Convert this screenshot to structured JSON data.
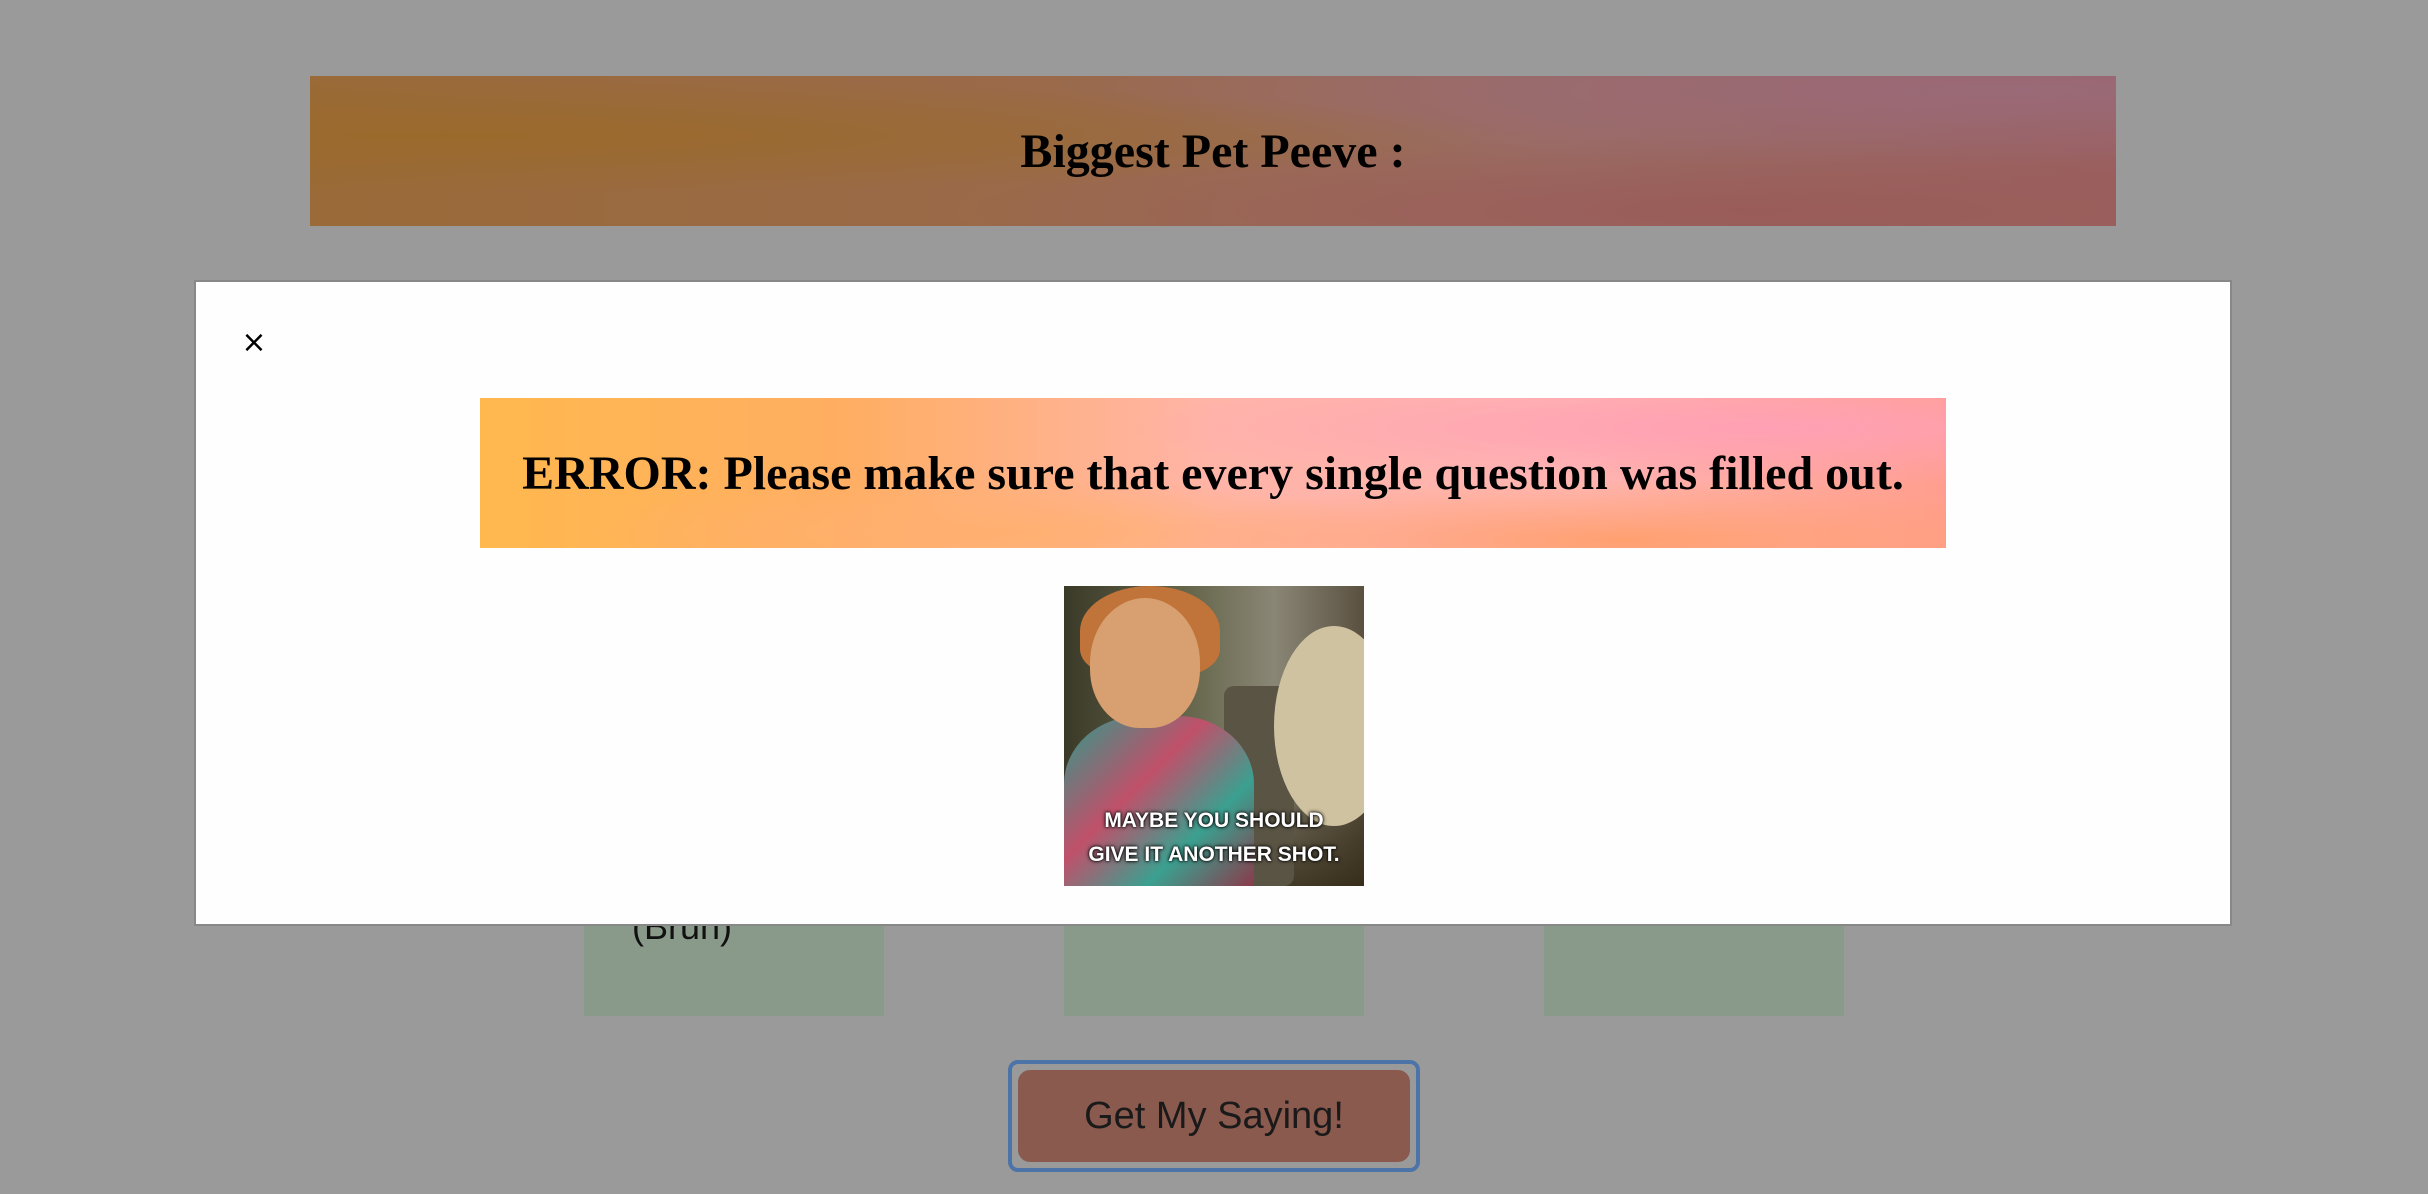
{
  "question": {
    "title": "Biggest Pet Peeve :"
  },
  "choices": [
    {
      "label": "(Bruh)"
    },
    {
      "label": ""
    },
    {
      "label": ""
    }
  ],
  "submit": {
    "label": "Get My Saying!"
  },
  "modal": {
    "close_symbol": "×",
    "error_message": "ERROR: Please make sure that every single question was filled out.",
    "gif_caption": "MAYBE YOU SHOULD\nGIVE IT ANOTHER SHOT."
  },
  "colors": {
    "overlay": "#9a9a9a",
    "modal_background": "#fefefe",
    "submit_button": "#8a5a4e",
    "choice_card": "#8a9a8a",
    "focus_ring": "#4d74a8"
  }
}
